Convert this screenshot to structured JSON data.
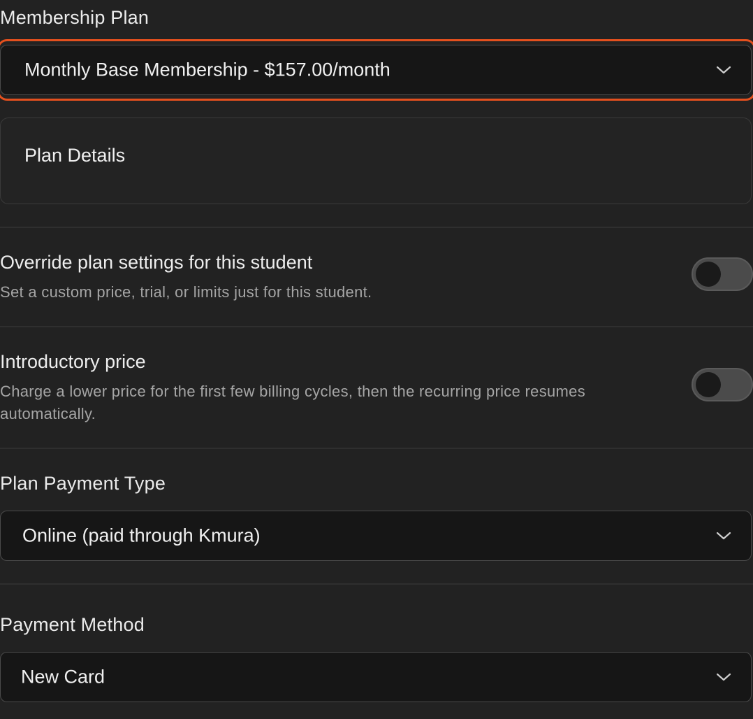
{
  "membership_plan": {
    "label": "Membership Plan",
    "selected": "Monthly Base Membership - $157.00/month"
  },
  "plan_details": {
    "title": "Plan Details"
  },
  "override_setting": {
    "title": "Override plan settings for this student",
    "description": "Set a custom price, trial, or limits just for this student.",
    "enabled": false
  },
  "intro_price_setting": {
    "title": "Introductory price",
    "description_line1": "Charge a lower price for the first few billing cycles, then the recurring price resumes",
    "description_line2": "automatically.",
    "enabled": false
  },
  "plan_payment_type": {
    "label": "Plan Payment Type",
    "selected": "Online (paid through Kmura)"
  },
  "payment_method": {
    "label": "Payment Method",
    "selected": "New Card"
  },
  "colors": {
    "background": "#222222",
    "focus_ring": "#e4501e",
    "select_bg": "#161616",
    "toggle_off": "#4b4b4b"
  }
}
